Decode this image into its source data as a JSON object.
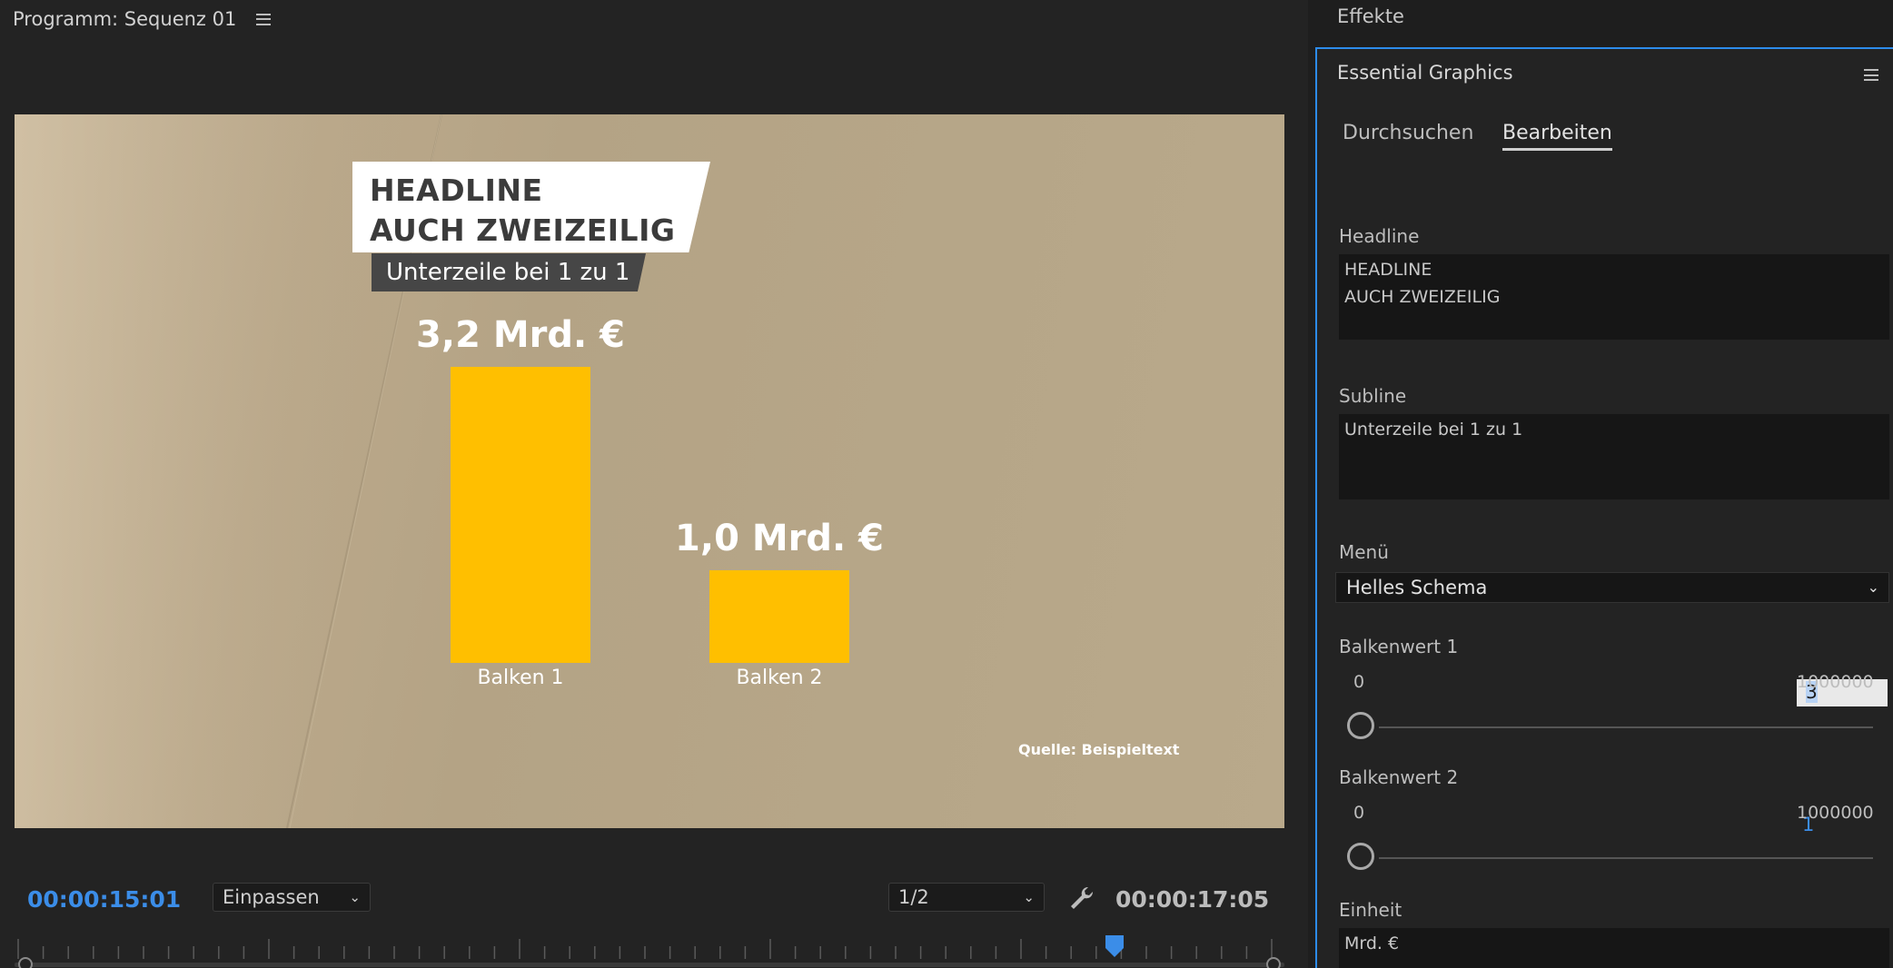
{
  "program": {
    "title": "Programm: Sequenz 01",
    "viewer": {
      "headline_lines": [
        "HEADLINE",
        "AUCH ZWEIZEILIG"
      ],
      "subline": "Unterzeile bei 1 zu 1",
      "bars": [
        {
          "value_label": "3,2 Mrd. €",
          "label": "Balken 1",
          "value": 3.2
        },
        {
          "value_label": "1,0 Mrd. €",
          "label": "Balken 2",
          "value": 1.0
        }
      ],
      "source": "Quelle: Beispieltext",
      "bar_color": "#ffbf00"
    },
    "current_timecode": "00:00:15:01",
    "zoom": "Einpassen",
    "resolution": "1/2",
    "duration_timecode": "00:00:17:05",
    "accent": "#3b8de8"
  },
  "effects_tab": "Effekte",
  "essential_graphics": {
    "title": "Essential Graphics",
    "tabs": [
      "Durchsuchen",
      "Bearbeiten"
    ],
    "active_tab": "Bearbeiten",
    "headline_label": "Headline",
    "headline_value": "HEADLINE\nAUCH ZWEIZEILIG",
    "subline_label": "Subline",
    "subline_value": "Unterzeile bei 1 zu 1",
    "menu_label": "Menü",
    "menu_value": "Helles Schema",
    "bar1": {
      "label": "Balkenwert 1",
      "value": "3",
      "min": "0",
      "max": "1000000"
    },
    "bar2": {
      "label": "Balkenwert 2",
      "value": "1",
      "min": "0",
      "max": "1000000"
    },
    "unit_label": "Einheit",
    "unit_value": "Mrd. €"
  }
}
